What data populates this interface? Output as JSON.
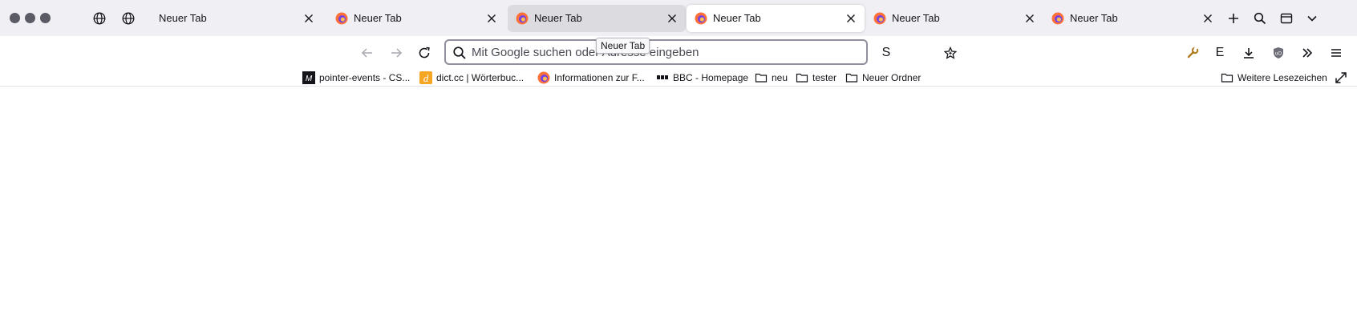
{
  "tabs": {
    "items": [
      {
        "label": "Neuer Tab",
        "state": "normal",
        "favicon": "none"
      },
      {
        "label": "Neuer Tab",
        "state": "normal",
        "favicon": "firefox-icon"
      },
      {
        "label": "Neuer Tab",
        "state": "hover",
        "favicon": "firefox-icon"
      },
      {
        "label": "Neuer Tab",
        "state": "active",
        "favicon": "firefox-icon"
      },
      {
        "label": "Neuer Tab",
        "state": "normal",
        "favicon": "firefox-icon"
      },
      {
        "label": "Neuer Tab",
        "state": "normal",
        "favicon": "firefox-icon"
      }
    ],
    "pinned_icons": [
      "globe-icon",
      "globe-icon"
    ],
    "tools": [
      "plus-icon",
      "search-icon",
      "sidebar-icon",
      "chevron-down-icon"
    ]
  },
  "navbar": {
    "url_placeholder": "Mit Google suchen oder Adresse eingeben",
    "tooltip": "Neuer Tab",
    "extension_s": "S",
    "extension_e": "E"
  },
  "bookmarks": {
    "items": [
      {
        "label": "pointer-events - CS...",
        "icon": "mdn-icon"
      },
      {
        "label": "dict.cc | Wörterbuc...",
        "icon": "dictcc-icon"
      },
      {
        "label": "Informationen zur F...",
        "icon": "firefox-icon"
      },
      {
        "label": "BBC - Homepage",
        "icon": "bbc-icon"
      },
      {
        "label": "neu",
        "icon": "folder-icon"
      },
      {
        "label": "tester",
        "icon": "folder-icon"
      },
      {
        "label": "Neuer Ordner",
        "icon": "folder-icon"
      }
    ],
    "more": "Weitere Lesezeichen"
  },
  "colors": {
    "toolbar_bg": "#f0f0f4",
    "accent": "#ff7139",
    "text": "#15141a"
  }
}
